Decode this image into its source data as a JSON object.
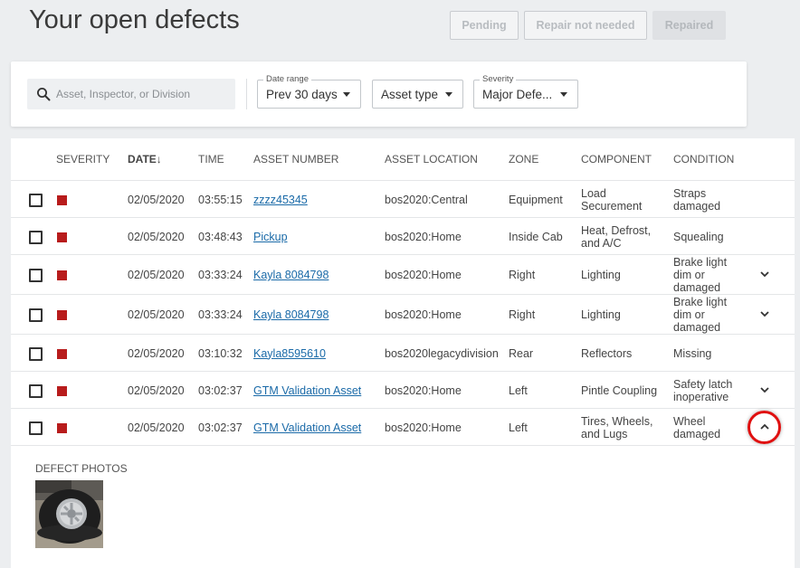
{
  "page": {
    "title": "Your open defects"
  },
  "status_tabs": [
    {
      "label": "Pending"
    },
    {
      "label": "Repair not needed"
    },
    {
      "label": "Repaired"
    }
  ],
  "filters": {
    "search_placeholder": "Asset, Inspector, or Division",
    "date_range": {
      "label": "Date range",
      "value": "Prev 30 days"
    },
    "asset_type": {
      "value": "Asset type"
    },
    "severity": {
      "label": "Severity",
      "value": "Major Defe..."
    }
  },
  "table": {
    "headers": [
      "SEVERITY",
      "DATE",
      "TIME",
      "ASSET NUMBER",
      "ASSET LOCATION",
      "ZONE",
      "COMPONENT",
      "CONDITION"
    ],
    "sort_indicator": "↓",
    "rows": [
      {
        "date": "02/05/2020",
        "time": "03:55:15",
        "asset": "zzzz45345",
        "location": "bos2020:Central",
        "zone": "Equipment",
        "component": "Load Securement",
        "condition": "Straps damaged",
        "chevron": "none"
      },
      {
        "date": "02/05/2020",
        "time": "03:48:43",
        "asset": "Pickup",
        "location": "bos2020:Home",
        "zone": "Inside Cab",
        "component": "Heat, Defrost, and A/C",
        "condition": "Squealing",
        "chevron": "none"
      },
      {
        "date": "02/05/2020",
        "time": "03:33:24",
        "asset": "Kayla 8084798",
        "location": "bos2020:Home",
        "zone": "Right",
        "component": "Lighting",
        "condition": "Brake light dim or damaged",
        "chevron": "down"
      },
      {
        "date": "02/05/2020",
        "time": "03:33:24",
        "asset": "Kayla 8084798",
        "location": "bos2020:Home",
        "zone": "Right",
        "component": "Lighting",
        "condition": "Brake light dim or damaged",
        "chevron": "down"
      },
      {
        "date": "02/05/2020",
        "time": "03:10:32",
        "asset": "Kayla8595610",
        "location": "bos2020legacydivision",
        "zone": "Rear",
        "component": "Reflectors",
        "condition": "Missing",
        "chevron": "none"
      },
      {
        "date": "02/05/2020",
        "time": "03:02:37",
        "asset": "GTM Validation Asset",
        "location": "bos2020:Home",
        "zone": "Left",
        "component": "Pintle Coupling",
        "condition": "Safety latch inoperative",
        "chevron": "down"
      },
      {
        "date": "02/05/2020",
        "time": "03:02:37",
        "asset": "GTM Validation Asset",
        "location": "bos2020:Home",
        "zone": "Left",
        "component": "Tires, Wheels, and Lugs",
        "condition": "Wheel damaged",
        "chevron": "up"
      }
    ]
  },
  "expanded": {
    "photos_label": "DEFECT PHOTOS"
  },
  "colors": {
    "severity_major": "#b81c1c",
    "link": "#1a6aa8",
    "highlight": "#e01010"
  }
}
